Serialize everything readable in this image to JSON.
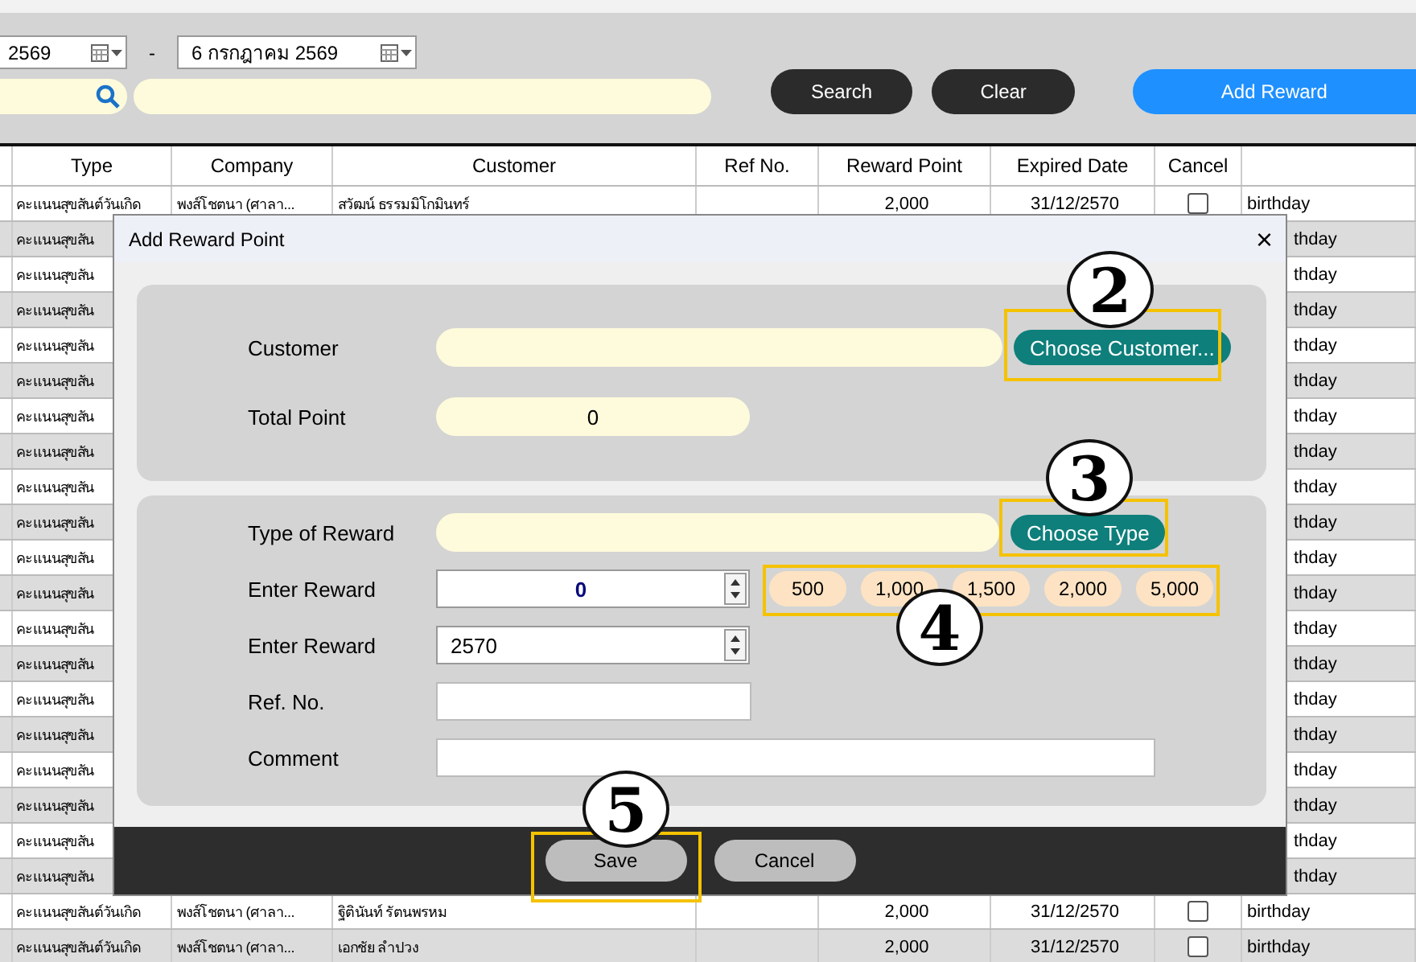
{
  "filter": {
    "date_from": "2569",
    "dash": "-",
    "date_to": "6 กรกฎาคม 2569",
    "buttons": [
      {
        "label": "Search",
        "kind": "dark"
      },
      {
        "label": "Clear",
        "kind": "dark"
      },
      {
        "label": "Add Reward",
        "kind": "primary"
      }
    ]
  },
  "table": {
    "columns": [
      "",
      "Type",
      "Company",
      "Customer",
      "Ref No.",
      "Reward Point",
      "Expired Date",
      "Cancel",
      ""
    ],
    "rows": [
      {
        "covered": false,
        "type": "คะแนนสุขสันต์วันเกิด",
        "company": "พงส์โชตนา (ศาลา...",
        "customer": "สวัฒน์ ธรรมมิโกมินทร์",
        "points": "2,000",
        "expires": "31/12/2570",
        "checked": false,
        "note": "birthday"
      },
      {
        "covered": true,
        "type": "คะแนนสุขสัน",
        "note": "thday"
      },
      {
        "covered": true,
        "type": "คะแนนสุขสัน",
        "note": "thday"
      },
      {
        "covered": true,
        "type": "คะแนนสุขสัน",
        "note": "thday"
      },
      {
        "covered": true,
        "type": "คะแนนสุขสัน",
        "note": "thday"
      },
      {
        "covered": true,
        "type": "คะแนนสุขสัน",
        "note": "thday"
      },
      {
        "covered": true,
        "type": "คะแนนสุขสัน",
        "note": "thday"
      },
      {
        "covered": true,
        "type": "คะแนนสุขสัน",
        "note": "thday"
      },
      {
        "covered": true,
        "type": "คะแนนสุขสัน",
        "note": "thday"
      },
      {
        "covered": true,
        "type": "คะแนนสุขสัน",
        "note": "thday"
      },
      {
        "covered": true,
        "type": "คะแนนสุขสัน",
        "note": "thday"
      },
      {
        "covered": true,
        "type": "คะแนนสุขสัน",
        "note": "thday"
      },
      {
        "covered": true,
        "type": "คะแนนสุขสัน",
        "note": "thday"
      },
      {
        "covered": true,
        "type": "คะแนนสุขสัน",
        "note": "thday"
      },
      {
        "covered": true,
        "type": "คะแนนสุขสัน",
        "note": "thday"
      },
      {
        "covered": true,
        "type": "คะแนนสุขสัน",
        "note": "thday"
      },
      {
        "covered": true,
        "type": "คะแนนสุขสัน",
        "note": "thday"
      },
      {
        "covered": true,
        "type": "คะแนนสุขสัน",
        "note": "thday"
      },
      {
        "covered": true,
        "type": "คะแนนสุขสัน",
        "note": "thday"
      },
      {
        "covered": true,
        "type": "คะแนนสุขสัน",
        "note": "thday"
      },
      {
        "covered": false,
        "type": "คะแนนสุขสันต์วันเกิด",
        "company": "พงส์โชตนา (ศาลา...",
        "customer": "ฐิตินันท์ รัตนพรหม",
        "points": "2,000",
        "expires": "31/12/2570",
        "checked": false,
        "note": "birthday"
      },
      {
        "covered": false,
        "type": "คะแนนสุขสันต์วันเกิด",
        "company": "พงส์โชตนา (ศาลา...",
        "customer": "เอกชัย ลำปวง",
        "points": "2,000",
        "expires": "31/12/2570",
        "checked": false,
        "note": "birthday"
      }
    ]
  },
  "dialog": {
    "title": "Add Reward Point",
    "close": "×",
    "customer": {
      "label": "Customer",
      "button": "Choose Customer..."
    },
    "total": {
      "label": "Total Point",
      "value": "0"
    },
    "type": {
      "label": "Type of Reward",
      "button": "Choose Type"
    },
    "reward": {
      "label": "Enter Reward",
      "value": "0",
      "presets": [
        "500",
        "1,000",
        "1,500",
        "2,000",
        "5,000"
      ]
    },
    "year": {
      "label": "Enter Reward",
      "value": "2570"
    },
    "ref": {
      "label": "Ref. No."
    },
    "comment": {
      "label": "Comment"
    },
    "buttons": [
      "Save",
      "Cancel"
    ]
  },
  "callouts": [
    "2",
    "3",
    "4",
    "5"
  ]
}
